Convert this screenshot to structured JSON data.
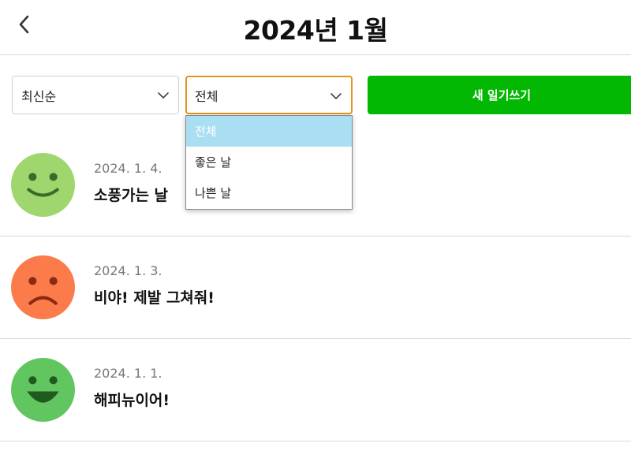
{
  "header": {
    "title": "2024년 1월",
    "back_icon": "chevron-left-icon"
  },
  "controls": {
    "sort": {
      "value": "최신순",
      "icon": "chevron-down-icon"
    },
    "filter": {
      "value": "전체",
      "icon": "chevron-down-icon",
      "options": [
        "전체",
        "좋은 날",
        "나쁜 날"
      ],
      "highlighted_option": "전체"
    },
    "new_button_label": "새 일기쓰기",
    "colors": {
      "primary": "#03b803",
      "focus_border": "#e0961c",
      "option_highlight": "#a9def3"
    }
  },
  "diaries": [
    {
      "date": "2024. 1. 4.",
      "content": "소풍가는 날",
      "emotion_icon": "smiling-face-icon",
      "emotion_color": "#9fd66e"
    },
    {
      "date": "2024. 1. 3.",
      "content": "비야! 제발 그쳐줘!",
      "emotion_icon": "frowning-face-icon",
      "emotion_color": "#fb7b4b"
    },
    {
      "date": "2024. 1. 1.",
      "content": "해피뉴이어!",
      "emotion_icon": "laughing-face-icon",
      "emotion_color": "#61c65f"
    }
  ]
}
